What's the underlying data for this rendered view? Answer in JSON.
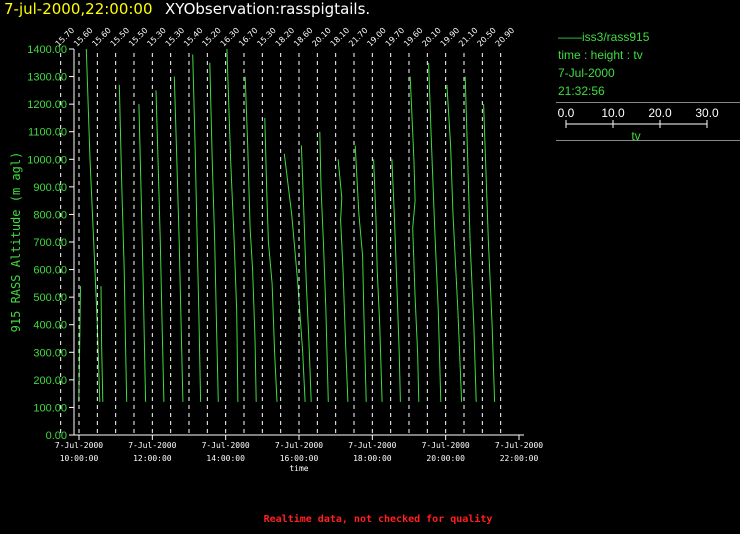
{
  "header": {
    "timestamp": "7-jul-2000,22:00:00",
    "title": "XYObservation:rasspigtails."
  },
  "legend": {
    "series_label": "iss3/rass915",
    "description": "time : height : tv",
    "date": "7-Jul-2000",
    "time": "21:32:56",
    "scale_ticks": [
      "0.0",
      "10.0",
      "20.0",
      "30.0"
    ],
    "scale_label": "tv"
  },
  "footer": {
    "notice": "Realtime data, not checked for quality"
  },
  "colors": {
    "line": "#3fdc3f",
    "axis": "#ffffff",
    "stamp": "#ffff00",
    "notice": "#ff2020"
  },
  "chart_data": {
    "type": "line",
    "title": "XYObservation:rasspigtails.",
    "xlabel": "time",
    "ylabel": "915 RASS Altitude (m agl)",
    "ylim": [
      0,
      1400
    ],
    "y_ticks": [
      "0.00",
      "100.00",
      "200.00",
      "300.00",
      "400.00",
      "500.00",
      "600.00",
      "700.00",
      "800.00",
      "900.00",
      "1000.00",
      "1100.00",
      "1200.00",
      "1300.00",
      "1400.00"
    ],
    "x_ticks": [
      {
        "date": "7-Jul-2000",
        "time": "10:00:00"
      },
      {
        "date": "7-Jul-2000",
        "time": "12:00:00"
      },
      {
        "date": "7-Jul-2000",
        "time": "14:00:00"
      },
      {
        "date": "7-Jul-2000",
        "time": "16:00:00"
      },
      {
        "date": "7-Jul-2000",
        "time": "18:00:00"
      },
      {
        "date": "7-Jul-2000",
        "time": "20:00:00"
      },
      {
        "date": "7-Jul-2000",
        "time": "22:00:00"
      }
    ],
    "x_range": [
      "10:00",
      "22:00"
    ],
    "grid": "dashed vertical line at each profile time",
    "legend_placement": "right",
    "tv_scale": [
      0,
      30
    ],
    "profiles": [
      {
        "time": "09:30",
        "label": "15.70",
        "points": [
          [
            14.8,
            120
          ],
          [
            15.6,
            330
          ],
          [
            16.2,
            540
          ]
        ]
      },
      {
        "time": "10:00",
        "label": "15.60",
        "points": [
          [
            6,
            1400
          ],
          [
            9,
            1000
          ],
          [
            12,
            700
          ],
          [
            15,
            400
          ],
          [
            17,
            120
          ]
        ]
      },
      {
        "time": "10:30",
        "label": "15.60",
        "points": [
          [
            3,
            540
          ],
          [
            3.5,
            330
          ],
          [
            4.5,
            120
          ]
        ]
      },
      {
        "time": "11:00",
        "label": "15.50",
        "points": [
          [
            3,
            1270
          ],
          [
            5,
            900
          ],
          [
            7,
            600
          ],
          [
            8,
            350
          ],
          [
            9,
            120
          ]
        ]
      },
      {
        "time": "11:30",
        "label": "15.50",
        "points": [
          [
            4,
            1200
          ],
          [
            6,
            850
          ],
          [
            7.5,
            550
          ],
          [
            8.5,
            330
          ],
          [
            9.5,
            120
          ]
        ]
      },
      {
        "time": "12:00",
        "label": "15.30",
        "points": [
          [
            3,
            1250
          ],
          [
            5,
            950
          ],
          [
            6.5,
            700
          ],
          [
            8,
            400
          ],
          [
            9.5,
            120
          ]
        ]
      },
      {
        "time": "12:30",
        "label": "15.30",
        "points": [
          [
            3,
            1300
          ],
          [
            5,
            1000
          ],
          [
            7,
            700
          ],
          [
            8.5,
            400
          ],
          [
            10,
            120
          ]
        ]
      },
      {
        "time": "13:00",
        "label": "15.40",
        "points": [
          [
            3,
            1380
          ],
          [
            5,
            1050
          ],
          [
            6.5,
            750
          ],
          [
            8,
            450
          ],
          [
            9.5,
            120
          ]
        ]
      },
      {
        "time": "13:30",
        "label": "15.20",
        "points": [
          [
            2,
            1350
          ],
          [
            4,
            1000
          ],
          [
            6,
            700
          ],
          [
            7.5,
            400
          ],
          [
            9,
            120
          ]
        ]
      },
      {
        "time": "14:00",
        "label": "16.30",
        "points": [
          [
            1,
            1400
          ],
          [
            4,
            1000
          ],
          [
            7,
            700
          ],
          [
            9,
            450
          ],
          [
            10,
            120
          ]
        ]
      },
      {
        "time": "14:30",
        "label": "16.70",
        "points": [
          [
            1,
            1300
          ],
          [
            3,
            1050
          ],
          [
            5,
            750
          ],
          [
            7,
            600
          ],
          [
            9,
            350
          ],
          [
            10,
            120
          ]
        ]
      },
      {
        "time": "15:00",
        "label": "15.30",
        "points": [
          [
            2,
            1150
          ],
          [
            3.5,
            900
          ],
          [
            5,
            700
          ],
          [
            8,
            550
          ],
          [
            10,
            300
          ],
          [
            12,
            120
          ]
        ]
      },
      {
        "time": "15:30",
        "label": "18.20",
        "points": [
          [
            3,
            1020
          ],
          [
            9,
            800
          ],
          [
            14,
            550
          ],
          [
            18,
            300
          ],
          [
            20,
            120
          ]
        ]
      },
      {
        "time": "16:00",
        "label": "18.60",
        "points": [
          [
            2,
            1050
          ],
          [
            4,
            800
          ],
          [
            6,
            550
          ],
          [
            8,
            350
          ],
          [
            10,
            120
          ]
        ]
      },
      {
        "time": "16:30",
        "label": "20.10",
        "points": [
          [
            2,
            1100
          ],
          [
            3,
            900
          ],
          [
            5,
            700
          ],
          [
            7,
            450
          ],
          [
            9,
            120
          ]
        ]
      },
      {
        "time": "17:00",
        "label": "18.10",
        "points": [
          [
            2,
            1000
          ],
          [
            5,
            860
          ],
          [
            4,
            780
          ],
          [
            6,
            600
          ],
          [
            8,
            350
          ],
          [
            10,
            120
          ]
        ]
      },
      {
        "time": "17:30",
        "label": "21.70",
        "points": [
          [
            1,
            1050
          ],
          [
            4,
            800
          ],
          [
            7,
            650
          ],
          [
            8,
            450
          ],
          [
            10,
            120
          ]
        ]
      },
      {
        "time": "18:00",
        "label": "19.00",
        "points": [
          [
            1,
            1000
          ],
          [
            3,
            780
          ],
          [
            4,
            600
          ],
          [
            6,
            400
          ],
          [
            8,
            120
          ]
        ]
      },
      {
        "time": "18:30",
        "label": "19.70",
        "points": [
          [
            1,
            1000
          ],
          [
            3,
            800
          ],
          [
            5,
            550
          ],
          [
            7,
            300
          ],
          [
            8,
            120
          ]
        ]
      },
      {
        "time": "19:00",
        "label": "19.60",
        "points": [
          [
            1,
            1300
          ],
          [
            4,
            1000
          ],
          [
            5,
            850
          ],
          [
            3,
            750
          ],
          [
            5,
            500
          ],
          [
            7,
            300
          ],
          [
            8,
            120
          ]
        ]
      },
      {
        "time": "19:30",
        "label": "20.10",
        "points": [
          [
            1,
            1350
          ],
          [
            3,
            1100
          ],
          [
            6,
            750
          ],
          [
            9,
            450
          ],
          [
            11,
            120
          ]
        ]
      },
      {
        "time": "20:00",
        "label": "19.90",
        "points": [
          [
            1,
            1270
          ],
          [
            4,
            1050
          ],
          [
            6,
            800
          ],
          [
            10,
            450
          ],
          [
            13,
            120
          ]
        ]
      },
      {
        "time": "20:30",
        "label": "21.10",
        "points": [
          [
            1,
            1300
          ],
          [
            3,
            1000
          ],
          [
            5,
            700
          ],
          [
            8,
            400
          ],
          [
            10,
            120
          ]
        ]
      },
      {
        "time": "21:00",
        "label": "20.50",
        "points": [
          [
            1,
            1200
          ],
          [
            3,
            950
          ],
          [
            5,
            700
          ],
          [
            8,
            400
          ],
          [
            10,
            120
          ]
        ]
      },
      {
        "time": "21:30",
        "label": "20.90",
        "points": []
      }
    ]
  }
}
